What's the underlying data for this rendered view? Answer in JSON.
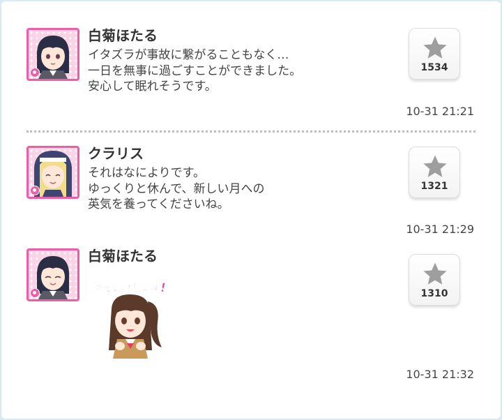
{
  "posts": [
    {
      "author": "白菊ほたる",
      "message": "イタズラが事故に繋がることもなく…\n一日を無事に過ごすことができました。\n安心して眠れそうです。",
      "likes": "1534",
      "timestamp": "10-31 21:21"
    },
    {
      "author": "クラリス",
      "message": "それはなによりです。\nゆっくりと休んで、新しい月への\n英気を養ってくださいね。",
      "likes": "1321",
      "timestamp": "10-31 21:29"
    },
    {
      "author": "白菊ほたる",
      "sticker_text": "がんばります!",
      "likes": "1310",
      "timestamp": "10-31 21:32"
    }
  ],
  "colors": {
    "accent_pink": "#ec5ea8",
    "star_gray": "#9e9e9e",
    "text": "#333333"
  },
  "icons": [
    "star-icon",
    "flower-badge-icon"
  ]
}
